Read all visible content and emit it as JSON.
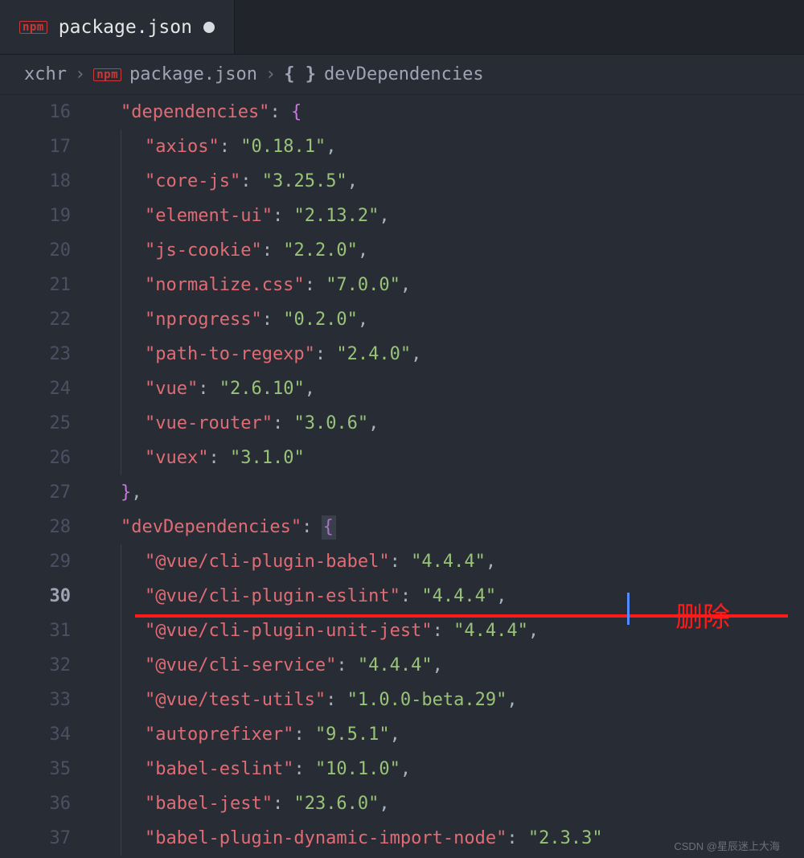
{
  "tab": {
    "filename": "package.json",
    "icon": "npm"
  },
  "breadcrumb": {
    "folder": "xchr",
    "file": "package.json",
    "symbol": "devDependencies"
  },
  "annotation": {
    "label": "删除"
  },
  "watermark": "CSDN @星辰迷上大海",
  "gutter_start": 16,
  "current_line": 30,
  "code": {
    "dependencies_key": "dependencies",
    "devDependencies_key": "devDependencies",
    "dependencies": [
      {
        "k": "axios",
        "v": "0.18.1"
      },
      {
        "k": "core-js",
        "v": "3.25.5"
      },
      {
        "k": "element-ui",
        "v": "2.13.2"
      },
      {
        "k": "js-cookie",
        "v": "2.2.0"
      },
      {
        "k": "normalize.css",
        "v": "7.0.0"
      },
      {
        "k": "nprogress",
        "v": "0.2.0"
      },
      {
        "k": "path-to-regexp",
        "v": "2.4.0"
      },
      {
        "k": "vue",
        "v": "2.6.10"
      },
      {
        "k": "vue-router",
        "v": "3.0.6"
      },
      {
        "k": "vuex",
        "v": "3.1.0"
      }
    ],
    "devDependencies": [
      {
        "k": "@vue/cli-plugin-babel",
        "v": "4.4.4"
      },
      {
        "k": "@vue/cli-plugin-eslint",
        "v": "4.4.4"
      },
      {
        "k": "@vue/cli-plugin-unit-jest",
        "v": "4.4.4"
      },
      {
        "k": "@vue/cli-service",
        "v": "4.4.4"
      },
      {
        "k": "@vue/test-utils",
        "v": "1.0.0-beta.29"
      },
      {
        "k": "autoprefixer",
        "v": "9.5.1"
      },
      {
        "k": "babel-eslint",
        "v": "10.1.0"
      },
      {
        "k": "babel-jest",
        "v": "23.6.0"
      },
      {
        "k": "babel-plugin-dynamic-import-node",
        "v": "2.3.3"
      }
    ]
  },
  "colors": {
    "bg": "#282c34",
    "key": "#e06c75",
    "string": "#98c379",
    "brace": "#c678dd",
    "punct": "#abb2bf"
  }
}
